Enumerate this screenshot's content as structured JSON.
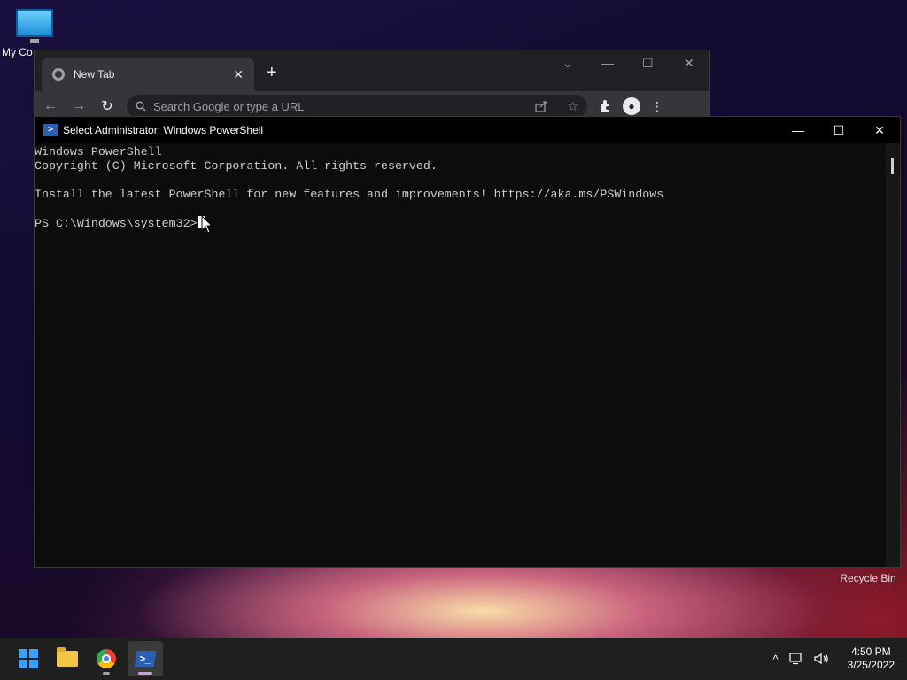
{
  "desktop": {
    "icons": [
      {
        "label": "My Co"
      },
      {
        "label": "Recycle Bin"
      }
    ]
  },
  "chrome": {
    "tab_title": "New Tab",
    "tab_close": "✕",
    "new_tab": "+",
    "omnibox_placeholder": "Search Google or type a URL",
    "controls": {
      "dropdown": "⌄",
      "minimize": "—",
      "maximize": "☐",
      "close": "✕"
    },
    "nav": {
      "back": "←",
      "forward": "→",
      "reload": "↻"
    }
  },
  "powershell": {
    "title": "Select Administrator: Windows PowerShell",
    "lines": [
      "Windows PowerShell",
      "Copyright (C) Microsoft Corporation. All rights reserved.",
      "",
      "Install the latest PowerShell for new features and improvements! https://aka.ms/PSWindows",
      ""
    ],
    "prompt": "PS C:\\Windows\\system32>",
    "controls": {
      "minimize": "—",
      "maximize": "☐",
      "close": "✕"
    }
  },
  "taskbar": {
    "clock_time": "4:50 PM",
    "clock_date": "3/25/2022",
    "tray_chevron": "^"
  },
  "colors": {
    "ps_background": "#0c0c0c",
    "ps_text": "#cccccc",
    "chrome_frame": "#202124",
    "taskbar": "#1f1f1f"
  }
}
